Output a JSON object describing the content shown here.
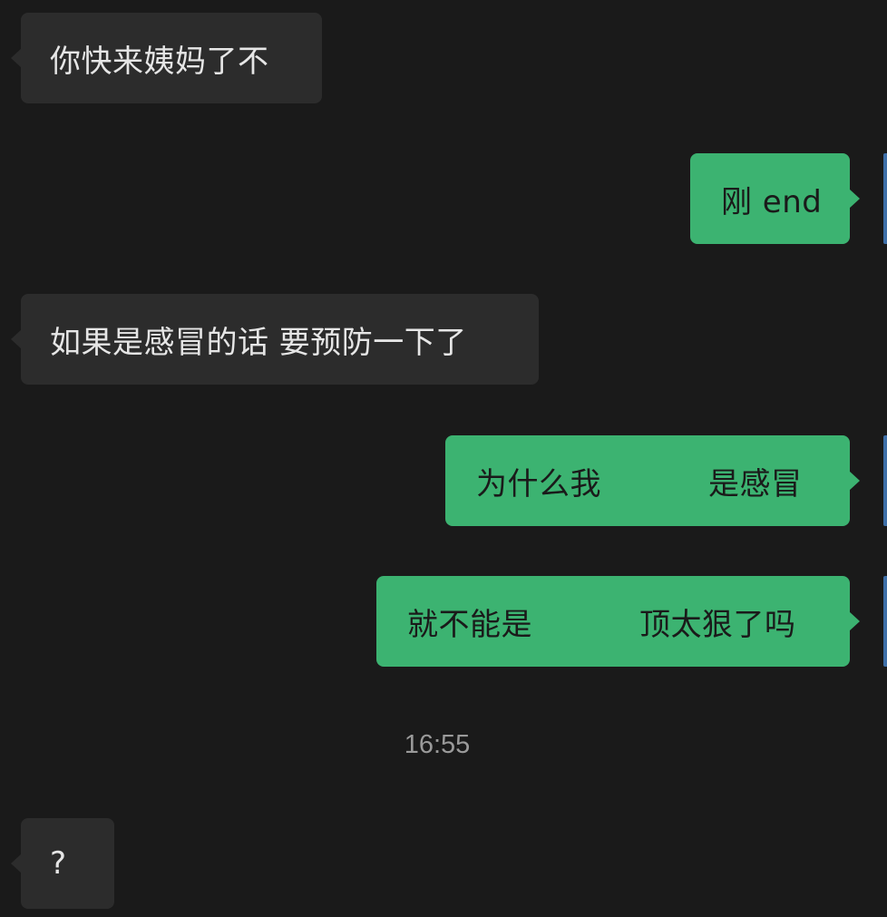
{
  "messages": [
    {
      "side": "incoming",
      "text": "你快来姨妈了不"
    },
    {
      "side": "outgoing",
      "text": "刚 end"
    },
    {
      "side": "incoming",
      "text": "如果是感冒的话 要预防一下了"
    },
    {
      "side": "outgoing",
      "part1": "为什么我",
      "part2": "是感冒"
    },
    {
      "side": "outgoing",
      "part1": "就不能是",
      "part2": "顶太狠了吗"
    },
    {
      "side": "incoming",
      "text": "?"
    }
  ],
  "timestamp": "16:55",
  "colors": {
    "background": "#1a1a1a",
    "incoming_bubble": "#2c2c2c",
    "outgoing_bubble": "#3cb371",
    "timestamp_text": "#9a9a9a"
  }
}
